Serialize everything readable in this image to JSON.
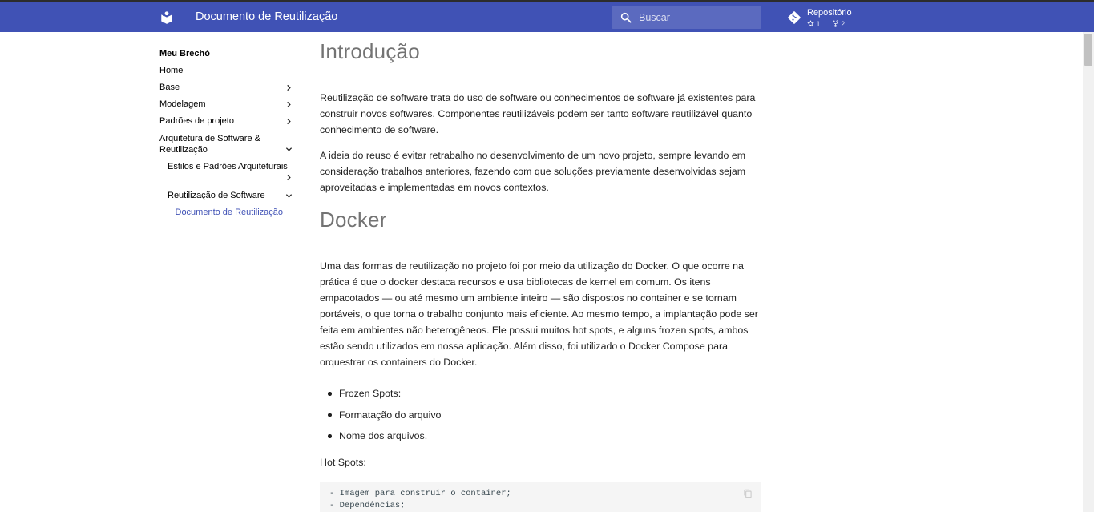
{
  "header": {
    "site_title": "Documento de Reutilização",
    "search_placeholder": "Buscar",
    "repo": {
      "name": "Repositório",
      "stars": "1",
      "forks": "2"
    },
    "colors": {
      "primary": "#4052b5",
      "text": "#ffffff"
    }
  },
  "nav": {
    "title": "Meu Brechó",
    "items": [
      {
        "label": "Home"
      },
      {
        "label": "Base"
      },
      {
        "label": "Modelagem"
      },
      {
        "label": "Padrões de projeto"
      },
      {
        "label": "Arquitetura de Software &"
      },
      {
        "label": "Reutilização"
      },
      {
        "label": "Estilos e Padrões Arquiteturais"
      },
      {
        "label": "Reutilização de Software"
      },
      {
        "label": "Documento de Reutilização"
      }
    ],
    "active_color": "#3f51b5"
  },
  "content": {
    "intro_heading": "Introdução",
    "intro_p1": "Reutilização de software trata do uso de software ou conhecimentos de software já existentes para construir novos softwares. Componentes reutilizáveis podem ser tanto software reutilizável quanto conhecimento de software.",
    "intro_p2": "A ideia do reuso é evitar retrabalho no desenvolvimento de um novo projeto, sempre levando em consideração trabalhos anteriores, fazendo com que soluções previamente desenvolvidas sejam aproveitadas e implementadas em novos contextos.",
    "docker_heading": "Docker",
    "docker_p1": "Uma das formas de reutilização no projeto foi por meio da utilização do Docker. O que ocorre na prática é que o docker destaca recursos e usa bibliotecas de kernel em comum. Os itens empacotados — ou até mesmo um ambiente inteiro — são dispostos no container e se tornam portáveis, o que torna o trabalho conjunto mais eficiente. Ao mesmo tempo, a implantação pode ser feita em ambientes não heterogêneos. Ele possui muitos hot spots, e alguns frozen spots, ambos estão sendo utilizados em nossa aplicação. Além disso, foi utilizado o Docker Compose para orquestrar os containers do Docker.",
    "bullets": [
      "Frozen Spots:",
      "Formatação do arquivo",
      "Nome dos arquivos."
    ],
    "hot_spots_label": "Hot Spots:",
    "code_lines": [
      "- Imagem para construir o container;",
      "- Dependências;"
    ]
  }
}
